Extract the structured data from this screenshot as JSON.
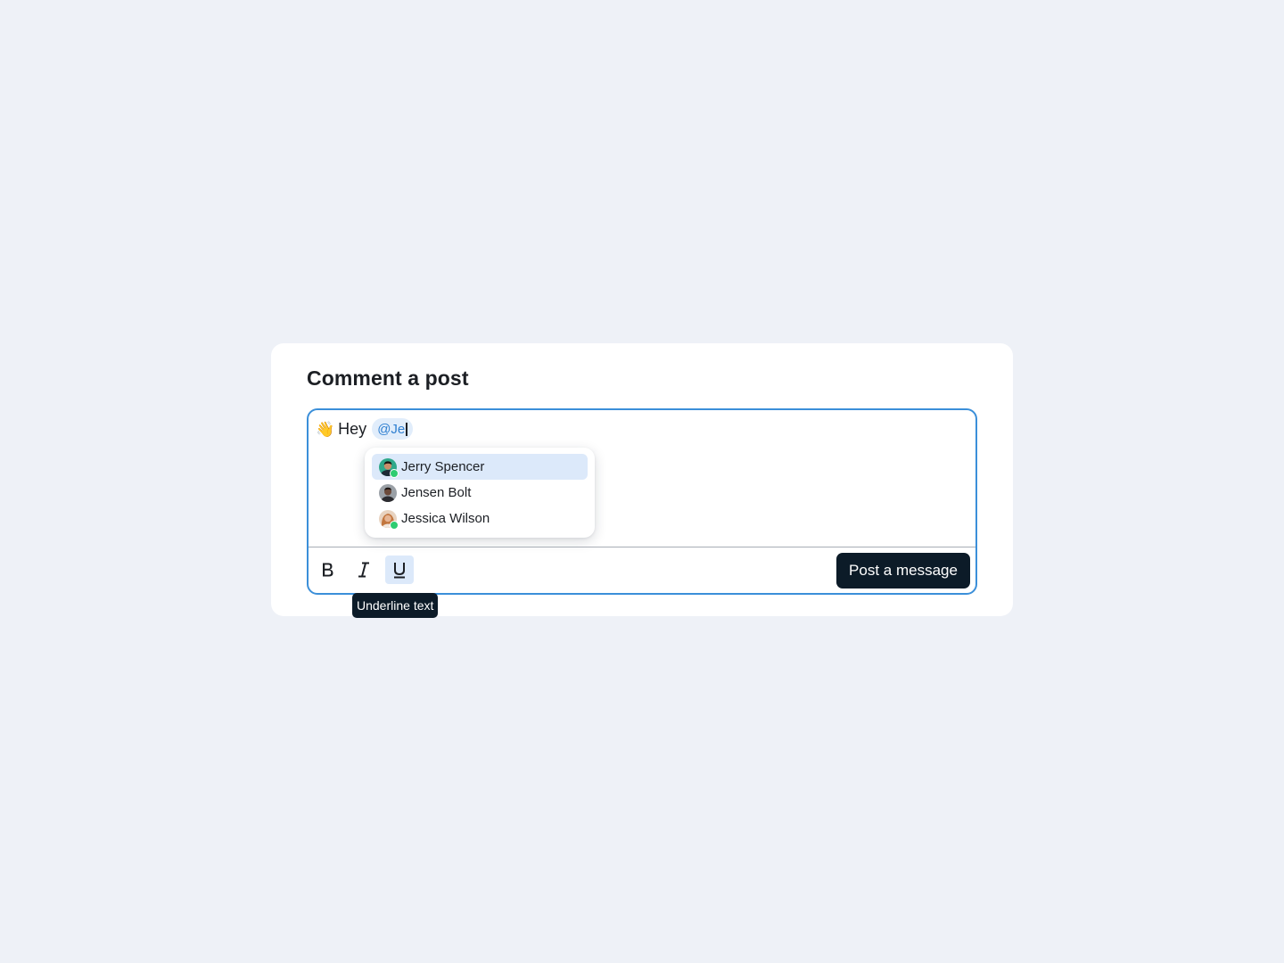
{
  "card": {
    "title": "Comment a post"
  },
  "editor": {
    "wave_emoji": "👋",
    "greeting": "Hey",
    "mention_text": "@Je"
  },
  "mention_dropdown": {
    "items": [
      {
        "label": "Jerry Spencer",
        "avatar": "avatar-jerry",
        "online": true,
        "selected": true
      },
      {
        "label": "Jensen Bolt",
        "avatar": "avatar-jensen",
        "online": false,
        "selected": false
      },
      {
        "label": "Jessica Wilson",
        "avatar": "avatar-jessica",
        "online": true,
        "selected": false
      }
    ]
  },
  "toolbar": {
    "bold_icon": "bold-icon",
    "italic_icon": "italic-icon",
    "underline_icon": "underline-icon",
    "post_label": "Post a message",
    "tooltip": "Underline text"
  },
  "colors": {
    "page_bg": "#eef1f7",
    "accent": "#3b8fd9",
    "mention_bg": "#e1edfb",
    "mention_text": "#2f7fd0",
    "selected_bg": "#dce9fa",
    "button_bg": "#0c1b28",
    "online": "#2ecc71"
  }
}
